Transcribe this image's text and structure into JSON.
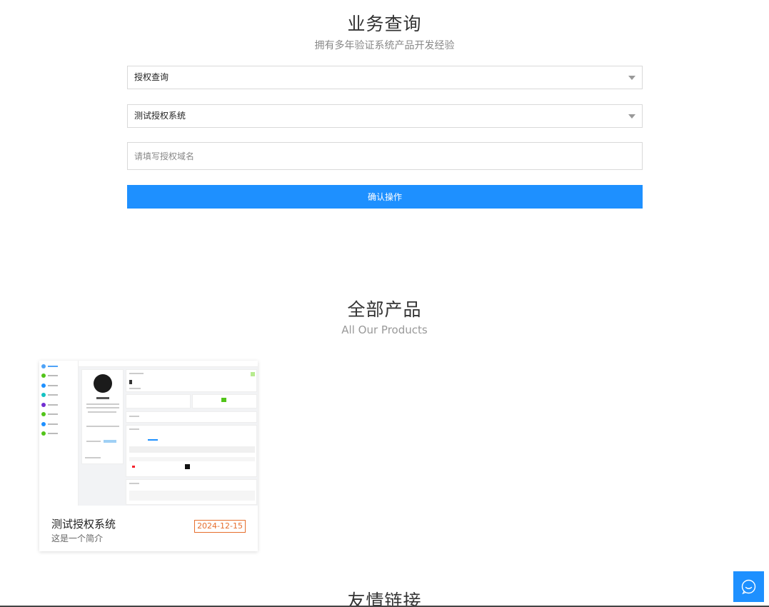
{
  "query": {
    "title": "业务查询",
    "subtitle": "拥有多年验证系统产品开发经验",
    "type_select": {
      "value": "授权查询"
    },
    "product_select": {
      "value": "测试授权系统"
    },
    "domain_input": {
      "placeholder": "请填写授权域名",
      "value": ""
    },
    "confirm_label": "确认操作"
  },
  "products": {
    "title": "全部产品",
    "subtitle": "All Our Products",
    "items": [
      {
        "name": "测试授权系统",
        "description": "这是一个简介",
        "date": "2024-12-15"
      }
    ]
  },
  "links": {
    "title": "友情链接"
  },
  "colors": {
    "accent": "#1e90ff",
    "date_tag": "#e66e2d"
  },
  "icons": {
    "chat": "chat-bubble-icon",
    "caret": "caret-down-icon"
  }
}
